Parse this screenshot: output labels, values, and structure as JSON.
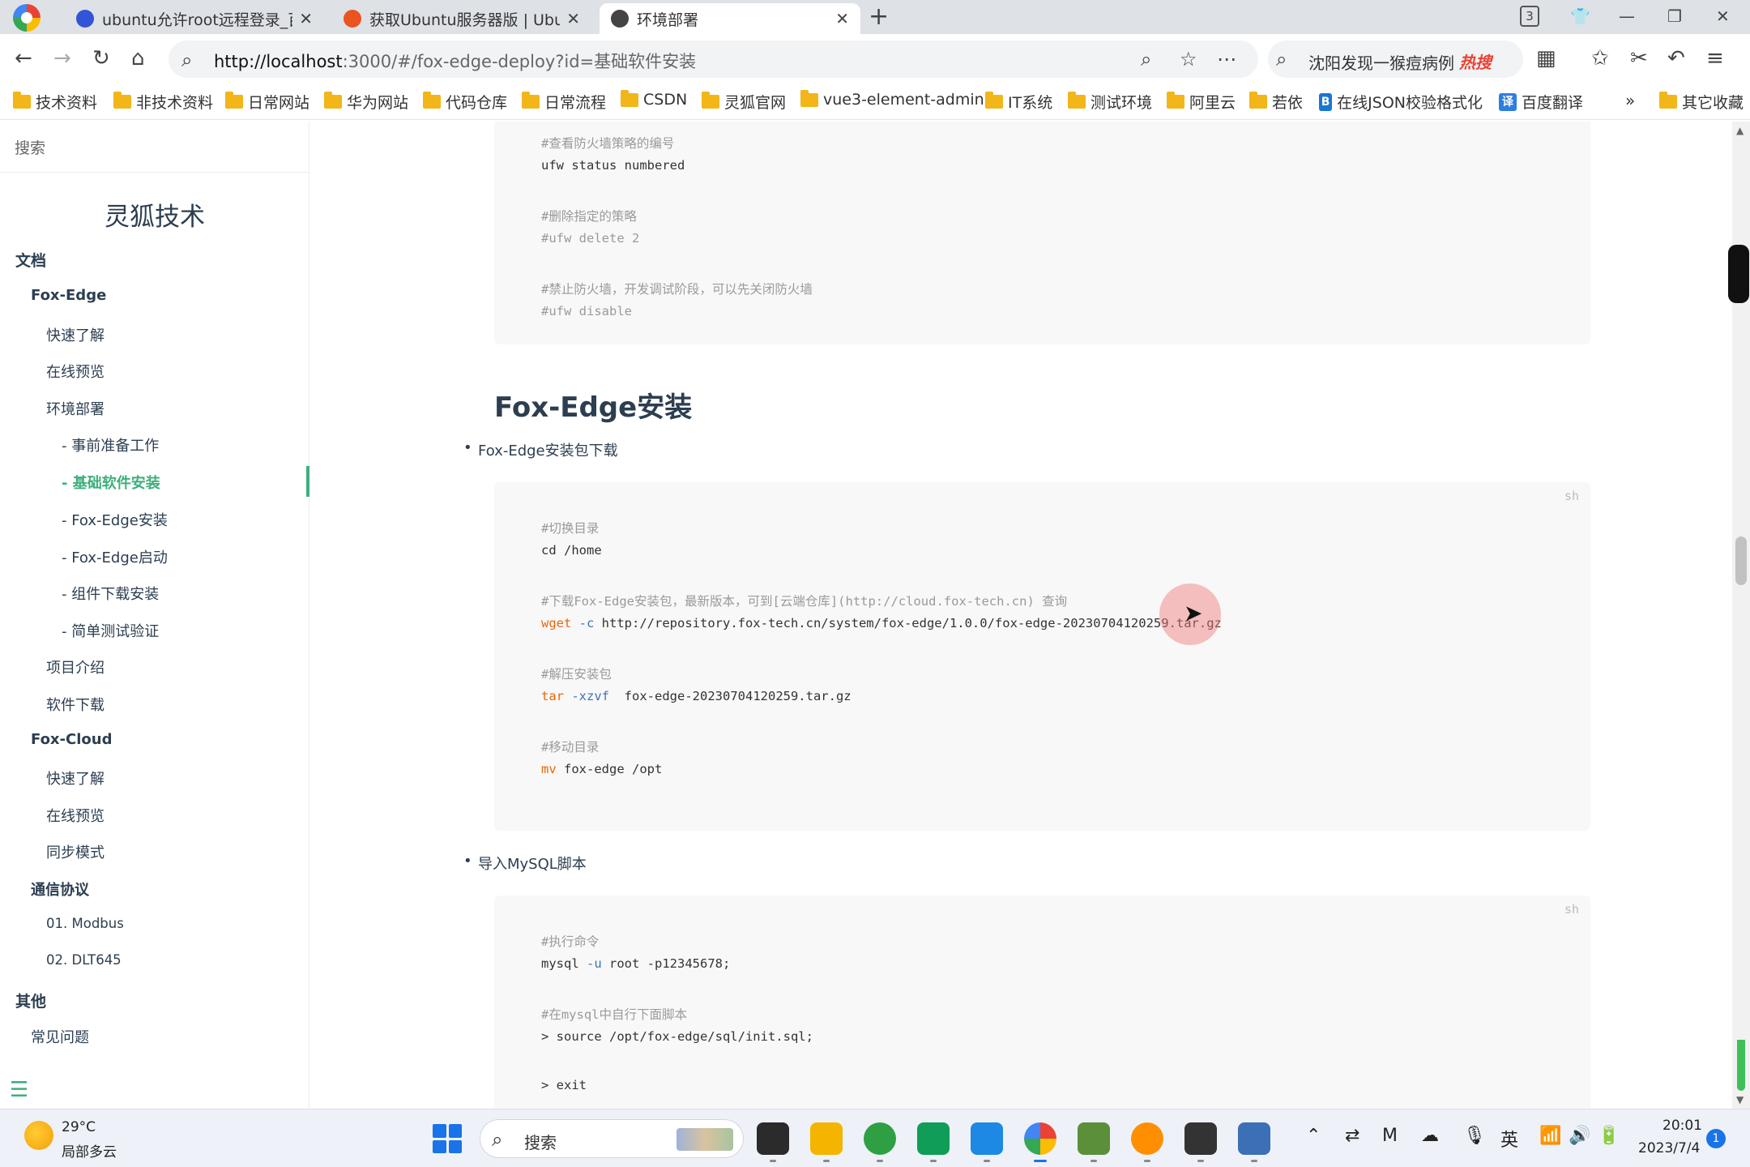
{
  "browser": {
    "tabs": [
      {
        "title": "ubuntu允许root远程登录_百",
        "active": false
      },
      {
        "title": "获取Ubuntu服务器版 | Ubun",
        "active": false
      },
      {
        "title": "环境部署",
        "active": true
      }
    ],
    "tab_count_badge": "3",
    "url_host": "http://localhost",
    "url_rest": ":3000/#/fox-edge-deploy?id=基础软件安装",
    "hot_search": "沈阳发现一猴痘病例",
    "hot_badge": "热搜",
    "bookmarks": [
      "技术资料",
      "非技术资料",
      "日常网站",
      "华为网站",
      "代码仓库",
      "日常流程",
      "CSDN",
      "灵狐官网",
      "vue3-element-admin",
      "IT系统",
      "测试环境",
      "阿里云",
      "若依",
      "在线JSON校验格式化",
      "百度翻译"
    ],
    "bookmarks_more": "»",
    "other_bookmarks": "其它收藏"
  },
  "sidebar": {
    "search_placeholder": "搜索",
    "site_title": "灵狐技术",
    "items": [
      {
        "label": "文档",
        "level": "h1"
      },
      {
        "label": "Fox-Edge",
        "level": "h2"
      },
      {
        "label": "快速了解",
        "level": "item"
      },
      {
        "label": "在线预览",
        "level": "item"
      },
      {
        "label": "环境部署",
        "level": "item"
      },
      {
        "label": "- 事前准备工作",
        "level": "sub"
      },
      {
        "label": "- 基础软件安装",
        "level": "sub",
        "active": true
      },
      {
        "label": "- Fox-Edge安装",
        "level": "sub"
      },
      {
        "label": "- Fox-Edge启动",
        "level": "sub"
      },
      {
        "label": "- 组件下载安装",
        "level": "sub"
      },
      {
        "label": "- 简单测试验证",
        "level": "sub"
      },
      {
        "label": "项目介绍",
        "level": "item"
      },
      {
        "label": "软件下载",
        "level": "item"
      },
      {
        "label": "Fox-Cloud",
        "level": "h2"
      },
      {
        "label": "快速了解",
        "level": "item"
      },
      {
        "label": "在线预览",
        "level": "item"
      },
      {
        "label": "同步模式",
        "level": "item"
      },
      {
        "label": "通信协议",
        "level": "h2"
      },
      {
        "label": "01. Modbus",
        "level": "item"
      },
      {
        "label": "02. DLT645",
        "level": "item"
      },
      {
        "label": "其他",
        "level": "h1"
      },
      {
        "label": "常见问题",
        "level": "h2-plain"
      }
    ]
  },
  "content": {
    "top_code": [
      "#查看防火墙策略的编号",
      "ufw status numbered",
      "#删除指定的策略",
      "#ufw delete 2",
      "#禁止防火墙，开发调试阶段，可以先关闭防火墙",
      "#ufw disable"
    ],
    "section_title": "Fox-Edge安装",
    "bullet1": "Fox-Edge安装包下载",
    "code1_lang": "sh",
    "code1": {
      "c1": "#切换目录",
      "l1": "cd /home",
      "c2": "#下载Fox-Edge安装包，最新版本，可到[云端仓库](http://cloud.fox-tech.cn) 查询",
      "l2_cmd": "wget",
      "l2_flag": "-c",
      "l2_rest": " http://repository.fox-tech.cn/system/fox-edge/1.0.0/fox-edge-20230704120259.tar.gz",
      "c3": "#解压安装包",
      "l3_cmd": "tar",
      "l3_flag": "-xzvf",
      "l3_rest": "  fox-edge-20230704120259.tar.gz",
      "c4": "#移动目录",
      "l4_cmd": "mv",
      "l4_rest": " fox-edge /opt"
    },
    "bullet2": "导入MySQL脚本",
    "code2_lang": "sh",
    "code2": {
      "c1": "#执行命令",
      "l1_a": "mysql ",
      "l1_flag": "-u",
      "l1_b": " root -p12345678;",
      "c2": "#在mysql中自行下面脚本",
      "l2": "> source /opt/fox-edge/sql/init.sql;",
      "l3": "> exit"
    }
  },
  "taskbar": {
    "weather_temp": "29°C",
    "weather_desc": "局部多云",
    "search_label": "搜索",
    "ime": "英",
    "time": "20:01",
    "date": "2023/7/4",
    "notifications": "1"
  }
}
